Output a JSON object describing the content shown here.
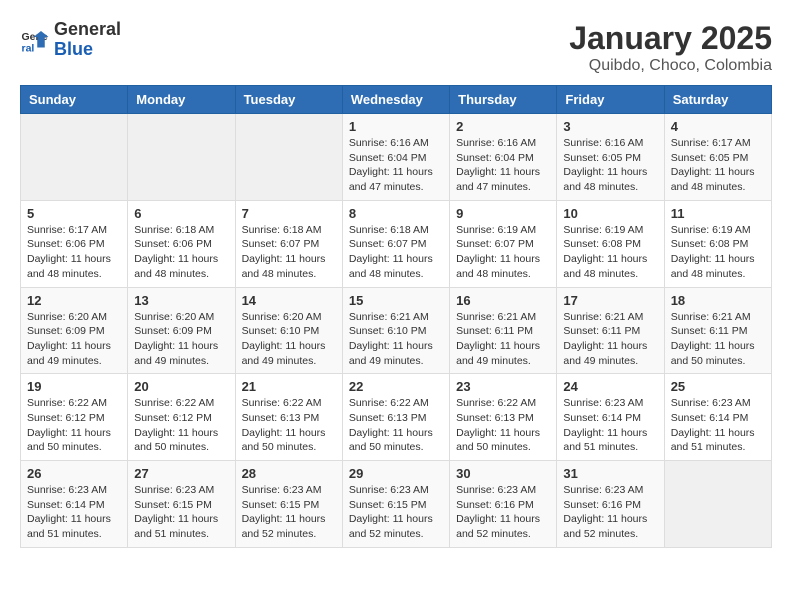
{
  "logo": {
    "general": "General",
    "blue": "Blue"
  },
  "header": {
    "title": "January 2025",
    "subtitle": "Quibdo, Choco, Colombia"
  },
  "weekdays": [
    "Sunday",
    "Monday",
    "Tuesday",
    "Wednesday",
    "Thursday",
    "Friday",
    "Saturday"
  ],
  "weeks": [
    [
      {
        "day": "",
        "info": ""
      },
      {
        "day": "",
        "info": ""
      },
      {
        "day": "",
        "info": ""
      },
      {
        "day": "1",
        "info": "Sunrise: 6:16 AM\nSunset: 6:04 PM\nDaylight: 11 hours and 47 minutes."
      },
      {
        "day": "2",
        "info": "Sunrise: 6:16 AM\nSunset: 6:04 PM\nDaylight: 11 hours and 47 minutes."
      },
      {
        "day": "3",
        "info": "Sunrise: 6:16 AM\nSunset: 6:05 PM\nDaylight: 11 hours and 48 minutes."
      },
      {
        "day": "4",
        "info": "Sunrise: 6:17 AM\nSunset: 6:05 PM\nDaylight: 11 hours and 48 minutes."
      }
    ],
    [
      {
        "day": "5",
        "info": "Sunrise: 6:17 AM\nSunset: 6:06 PM\nDaylight: 11 hours and 48 minutes."
      },
      {
        "day": "6",
        "info": "Sunrise: 6:18 AM\nSunset: 6:06 PM\nDaylight: 11 hours and 48 minutes."
      },
      {
        "day": "7",
        "info": "Sunrise: 6:18 AM\nSunset: 6:07 PM\nDaylight: 11 hours and 48 minutes."
      },
      {
        "day": "8",
        "info": "Sunrise: 6:18 AM\nSunset: 6:07 PM\nDaylight: 11 hours and 48 minutes."
      },
      {
        "day": "9",
        "info": "Sunrise: 6:19 AM\nSunset: 6:07 PM\nDaylight: 11 hours and 48 minutes."
      },
      {
        "day": "10",
        "info": "Sunrise: 6:19 AM\nSunset: 6:08 PM\nDaylight: 11 hours and 48 minutes."
      },
      {
        "day": "11",
        "info": "Sunrise: 6:19 AM\nSunset: 6:08 PM\nDaylight: 11 hours and 48 minutes."
      }
    ],
    [
      {
        "day": "12",
        "info": "Sunrise: 6:20 AM\nSunset: 6:09 PM\nDaylight: 11 hours and 49 minutes."
      },
      {
        "day": "13",
        "info": "Sunrise: 6:20 AM\nSunset: 6:09 PM\nDaylight: 11 hours and 49 minutes."
      },
      {
        "day": "14",
        "info": "Sunrise: 6:20 AM\nSunset: 6:10 PM\nDaylight: 11 hours and 49 minutes."
      },
      {
        "day": "15",
        "info": "Sunrise: 6:21 AM\nSunset: 6:10 PM\nDaylight: 11 hours and 49 minutes."
      },
      {
        "day": "16",
        "info": "Sunrise: 6:21 AM\nSunset: 6:11 PM\nDaylight: 11 hours and 49 minutes."
      },
      {
        "day": "17",
        "info": "Sunrise: 6:21 AM\nSunset: 6:11 PM\nDaylight: 11 hours and 49 minutes."
      },
      {
        "day": "18",
        "info": "Sunrise: 6:21 AM\nSunset: 6:11 PM\nDaylight: 11 hours and 50 minutes."
      }
    ],
    [
      {
        "day": "19",
        "info": "Sunrise: 6:22 AM\nSunset: 6:12 PM\nDaylight: 11 hours and 50 minutes."
      },
      {
        "day": "20",
        "info": "Sunrise: 6:22 AM\nSunset: 6:12 PM\nDaylight: 11 hours and 50 minutes."
      },
      {
        "day": "21",
        "info": "Sunrise: 6:22 AM\nSunset: 6:13 PM\nDaylight: 11 hours and 50 minutes."
      },
      {
        "day": "22",
        "info": "Sunrise: 6:22 AM\nSunset: 6:13 PM\nDaylight: 11 hours and 50 minutes."
      },
      {
        "day": "23",
        "info": "Sunrise: 6:22 AM\nSunset: 6:13 PM\nDaylight: 11 hours and 50 minutes."
      },
      {
        "day": "24",
        "info": "Sunrise: 6:23 AM\nSunset: 6:14 PM\nDaylight: 11 hours and 51 minutes."
      },
      {
        "day": "25",
        "info": "Sunrise: 6:23 AM\nSunset: 6:14 PM\nDaylight: 11 hours and 51 minutes."
      }
    ],
    [
      {
        "day": "26",
        "info": "Sunrise: 6:23 AM\nSunset: 6:14 PM\nDaylight: 11 hours and 51 minutes."
      },
      {
        "day": "27",
        "info": "Sunrise: 6:23 AM\nSunset: 6:15 PM\nDaylight: 11 hours and 51 minutes."
      },
      {
        "day": "28",
        "info": "Sunrise: 6:23 AM\nSunset: 6:15 PM\nDaylight: 11 hours and 52 minutes."
      },
      {
        "day": "29",
        "info": "Sunrise: 6:23 AM\nSunset: 6:15 PM\nDaylight: 11 hours and 52 minutes."
      },
      {
        "day": "30",
        "info": "Sunrise: 6:23 AM\nSunset: 6:16 PM\nDaylight: 11 hours and 52 minutes."
      },
      {
        "day": "31",
        "info": "Sunrise: 6:23 AM\nSunset: 6:16 PM\nDaylight: 11 hours and 52 minutes."
      },
      {
        "day": "",
        "info": ""
      }
    ]
  ]
}
